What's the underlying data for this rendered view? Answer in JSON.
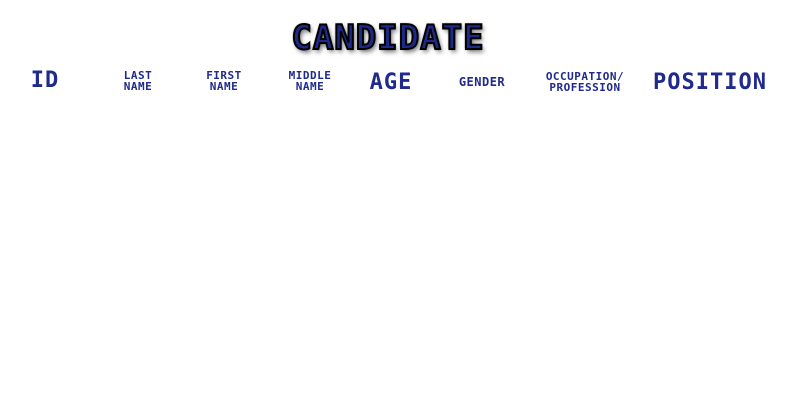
{
  "title": "CANDIDATE",
  "columns": {
    "id": "ID",
    "last_name": [
      "LAST",
      "NAME"
    ],
    "first_name": [
      "FIRST",
      "NAME"
    ],
    "middle_name": [
      "MIDDLE",
      "NAME"
    ],
    "age": "AGE",
    "gender": "GENDER",
    "occupation": [
      "OCCUPATION/",
      "PROFESSION"
    ],
    "position": "POSITION"
  }
}
